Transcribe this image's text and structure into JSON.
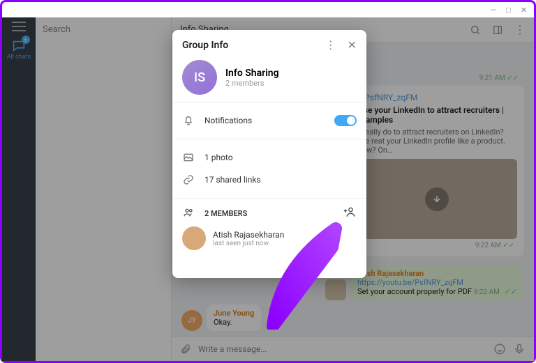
{
  "window": {
    "minimize": "—",
    "maximize": "□",
    "close": "✕"
  },
  "sidebar": {
    "allchats_label": "All chats",
    "badge": "6"
  },
  "search": {
    "placeholder": "Search"
  },
  "chat": {
    "title": "Info Sharing",
    "preview_link_tail": "e/PsfNRY_zqFM",
    "preview_title_tail": "nise your LinkedIn to attract recruiters | Examples",
    "preview_desc_tail": "n really do to attract recruiters on LinkedIn? The             reat your LinkedIn profile like a product. How? On…",
    "time1": "9:21 AM",
    "time2": "9:22 AM",
    "time3": "9:22 AM",
    "atish_name": "Atish Rajasekharan",
    "atish_link": "https://youtu.be/PsfNRY_zqFM",
    "atish_text": "Set your account properly for PDF",
    "june_name": "June Young",
    "june_text": "Okay.",
    "avatar_jy": "JY"
  },
  "composer": {
    "placeholder": "Write a message..."
  },
  "modal": {
    "title": "Group Info",
    "group_initials": "IS",
    "group_name": "Info Sharing",
    "group_sub": "2 members",
    "notifications": "Notifications",
    "photo": "1 photo",
    "links": "17 shared links",
    "members_header": "2 MEMBERS",
    "member1_name": "Atish Rajasekharan",
    "member1_sub": "last seen just now"
  }
}
